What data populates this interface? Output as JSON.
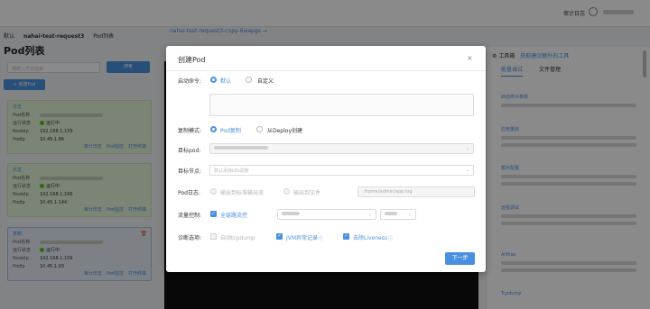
{
  "topbar": {
    "audit_label": "审计日志"
  },
  "breadcrumb": {
    "item1": "默认",
    "item2": "nahai-test-request3",
    "item3": "Pod列表"
  },
  "page": {
    "title": "Pod列表",
    "search_placeholder": "根据入方式检索",
    "search_button": "搜索",
    "create_button": "+ 创建Pod"
  },
  "pods": [
    {
      "head": "日志",
      "fields": [
        {
          "k": "Pod名称",
          "v": ""
        },
        {
          "k": "运行状态",
          "v": "运行中"
        },
        {
          "k": "NodeIp",
          "v": "192.168.1.159"
        },
        {
          "k": "PodIp",
          "v": "10.45.1.86"
        }
      ],
      "actions": [
        "审计日志",
        "Pod监控",
        "打开终端"
      ]
    },
    {
      "head": "日志",
      "fields": [
        {
          "k": "Pod名称",
          "v": ""
        },
        {
          "k": "运行状态",
          "v": "运行中"
        },
        {
          "k": "NodeIp",
          "v": "192.168.1.166"
        },
        {
          "k": "PodIp",
          "v": "10.45.1.144"
        }
      ],
      "actions": [
        "审计日志",
        "Pod监控",
        "打开终端"
      ]
    },
    {
      "head": "复制",
      "fields": [
        {
          "k": "Pod名称",
          "v": ""
        },
        {
          "k": "运行状态",
          "v": "运行中"
        },
        {
          "k": "NodeIp",
          "v": "192.168.1.159"
        },
        {
          "k": "PodIp",
          "v": "10.45.1.93"
        }
      ],
      "actions": [
        "审计日志",
        "Pod监控",
        "打开终端"
      ]
    }
  ],
  "middle": {
    "title": "nahai-test-request3-copy-6wapgs →"
  },
  "right_panel": {
    "header": "工具箱",
    "header_sub": "获取建议额外的工具",
    "tabs": [
      "能量调试",
      "文件管理"
    ],
    "items": [
      "启动命令参数",
      "应用重启",
      "额外配置",
      "远程调试",
      "Arthas",
      "Tcpdump"
    ]
  },
  "modal": {
    "title": "创建Pod",
    "close": "×",
    "startup": {
      "label": "启动命令:",
      "opt_default": "默认",
      "opt_custom": "自定义"
    },
    "copy_mode": {
      "label": "复制模式:",
      "opt_pod": "Pod复制",
      "opt_deploy": "从Deploy创建"
    },
    "target_pod": {
      "label": "目标pod:"
    },
    "target_node": {
      "label": "目标节点:",
      "placeholder": "默认承接k8s调度"
    },
    "pod_log": {
      "label": "Pod日志:",
      "opt_stdout": "输出到标准输出流",
      "opt_file": "输出到文件",
      "path_placeholder": "/home/admin/app.log"
    },
    "traffic": {
      "label": "流量控制:",
      "checkbox": "全链路流控"
    },
    "diag": {
      "label": "诊断选项:",
      "tcpdump": "启动tcpdump",
      "jvm": "JVM异常记录",
      "liveness": "去除Liveness"
    },
    "next_button": "下一步"
  }
}
